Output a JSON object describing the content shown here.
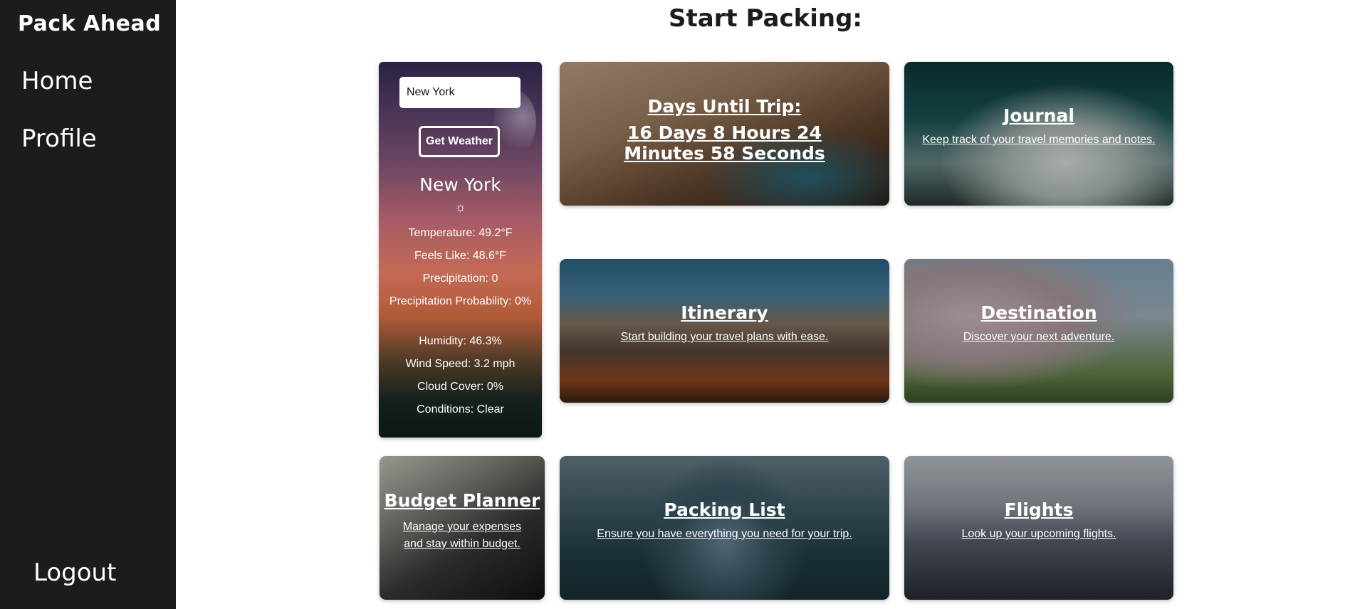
{
  "sidebar": {
    "brand": "Pack Ahead",
    "nav": {
      "home": "Home",
      "profile": "Profile",
      "logout": "Logout"
    }
  },
  "page": {
    "title": "Start Packing:"
  },
  "weather": {
    "input_value": "New York",
    "button_label": "Get Weather",
    "city": "New York",
    "icon": "sun-icon",
    "icon_glyph": "☼",
    "temperature": "Temperature: 49.2°F",
    "feels_like": "Feels Like: 48.6°F",
    "precipitation": "Precipitation: 0",
    "precip_probability": "Precipitation Probability: 0%",
    "humidity": "Humidity: 46.3%",
    "wind_speed": "Wind Speed: 3.2 mph",
    "cloud_cover": "Cloud Cover: 0%",
    "conditions": "Conditions: Clear"
  },
  "cards": {
    "days": {
      "title": "Days Until Trip:",
      "countdown": "16 Days 8 Hours 24 Minutes 58 Seconds"
    },
    "journal": {
      "title": "Journal",
      "desc": "Keep track of your travel memories and notes."
    },
    "itinerary": {
      "title": "Itinerary",
      "desc": "Start building your travel plans with ease."
    },
    "destination": {
      "title": "Destination",
      "desc": "Discover your next adventure."
    },
    "budget": {
      "title": "Budget Planner",
      "desc": "Manage your expenses and stay within budget."
    },
    "packing": {
      "title": "Packing List",
      "desc": "Ensure you have everything you need for your trip."
    },
    "flights": {
      "title": "Flights",
      "desc": "Look up your upcoming flights."
    }
  }
}
